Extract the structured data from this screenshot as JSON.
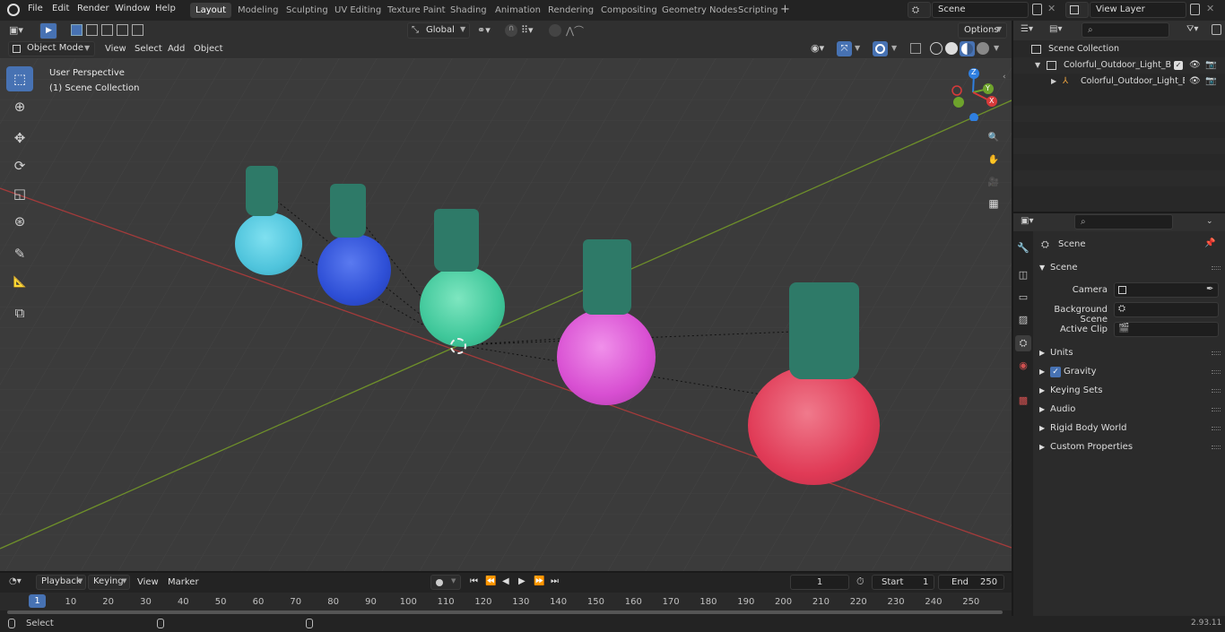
{
  "menus": [
    "File",
    "Edit",
    "Render",
    "Window",
    "Help"
  ],
  "workspaces": [
    {
      "label": "Layout",
      "active": true
    },
    {
      "label": "Modeling",
      "active": false
    },
    {
      "label": "Sculpting",
      "active": false
    },
    {
      "label": "UV Editing",
      "active": false
    },
    {
      "label": "Texture Paint",
      "active": false
    },
    {
      "label": "Shading",
      "active": false
    },
    {
      "label": "Animation",
      "active": false
    },
    {
      "label": "Rendering",
      "active": false
    },
    {
      "label": "Compositing",
      "active": false
    },
    {
      "label": "Geometry Nodes",
      "active": false
    },
    {
      "label": "Scripting",
      "active": false
    }
  ],
  "add_workspace": "+",
  "scene_field": "Scene",
  "view_layer_field": "View Layer",
  "viewport_header": {
    "transform_orientation": "Global",
    "options_label": "Options",
    "mode": "Object Mode",
    "menu_items": [
      "View",
      "Select",
      "Add",
      "Object"
    ]
  },
  "viewport": {
    "perspective_label": "User Perspective",
    "collection_label": "(1) Scene Collection",
    "gizmo_axes": [
      "Z",
      "Y",
      "X"
    ],
    "bulbs": [
      {
        "name": "cyan-bulb",
        "color": "#4fc4dc"
      },
      {
        "name": "blue-bulb",
        "color": "#2e4fd6"
      },
      {
        "name": "green-bulb",
        "color": "#3fc79a"
      },
      {
        "name": "magenta-bulb",
        "color": "#d84fd2"
      },
      {
        "name": "red-bulb",
        "color": "#e03a56"
      }
    ],
    "socket_color": "#2e7a68",
    "grid_colors": {
      "x_axis": "#a33b3b",
      "y_axis": "#6e8f2a",
      "background": "#3b3b3b"
    }
  },
  "tools": [
    {
      "name": "select-box-tool",
      "icon": "select-box-icon",
      "glyph": "⬚",
      "active": true
    },
    {
      "name": "cursor-tool",
      "icon": "cursor-icon",
      "glyph": "⊕",
      "active": false
    },
    {
      "name": "move-tool",
      "icon": "move-icon",
      "glyph": "✥",
      "active": false
    },
    {
      "name": "rotate-tool",
      "icon": "rotate-icon",
      "glyph": "⟳",
      "active": false
    },
    {
      "name": "scale-tool",
      "icon": "scale-icon",
      "glyph": "◱",
      "active": false
    },
    {
      "name": "transform-tool",
      "icon": "transform-icon",
      "glyph": "⊛",
      "active": false
    },
    {
      "name": "annotate-tool",
      "icon": "annotate-icon",
      "glyph": "✎",
      "active": false
    },
    {
      "name": "measure-tool",
      "icon": "measure-icon",
      "glyph": "📐",
      "active": false
    },
    {
      "name": "add-cube-tool",
      "icon": "add-cube-icon",
      "glyph": "⧉",
      "active": false
    }
  ],
  "nav_buttons": [
    {
      "name": "zoom-button",
      "icon": "zoom-icon",
      "glyph": "🔍"
    },
    {
      "name": "pan-button",
      "icon": "hand-icon",
      "glyph": "✋"
    },
    {
      "name": "camera-view-button",
      "icon": "camera-icon",
      "glyph": "🎥"
    },
    {
      "name": "ortho-toggle-button",
      "icon": "grid-icon",
      "glyph": "▦"
    }
  ],
  "outliner": {
    "rows": [
      {
        "label": "Scene Collection",
        "indent": 0
      },
      {
        "label": "Colorful_Outdoor_Light_Bulbs",
        "indent": 1
      },
      {
        "label": "Colorful_Outdoor_Light_E",
        "indent": 2
      }
    ]
  },
  "properties": {
    "context_title": "Scene",
    "section_title": "Scene",
    "fields": [
      {
        "label": "Camera"
      },
      {
        "label": "Background Scene"
      },
      {
        "label": "Active Clip"
      }
    ],
    "panels": [
      "Units",
      "Gravity",
      "Keying Sets",
      "Audio",
      "Rigid Body World",
      "Custom Properties"
    ],
    "gravity_checked": true
  },
  "timeline": {
    "menus": [
      "Playback",
      "Keying",
      "View",
      "Marker"
    ],
    "current_frame": "1",
    "start_label": "Start",
    "start_value": "1",
    "end_label": "End",
    "end_value": "250",
    "ruler_current": "1",
    "ticks": [
      "10",
      "20",
      "30",
      "40",
      "50",
      "60",
      "70",
      "80",
      "90",
      "100",
      "110",
      "120",
      "130",
      "140",
      "150",
      "160",
      "170",
      "180",
      "190",
      "200",
      "210",
      "220",
      "230",
      "240",
      "250"
    ]
  },
  "status": {
    "left_label": "Select",
    "version": "2.93.11"
  }
}
